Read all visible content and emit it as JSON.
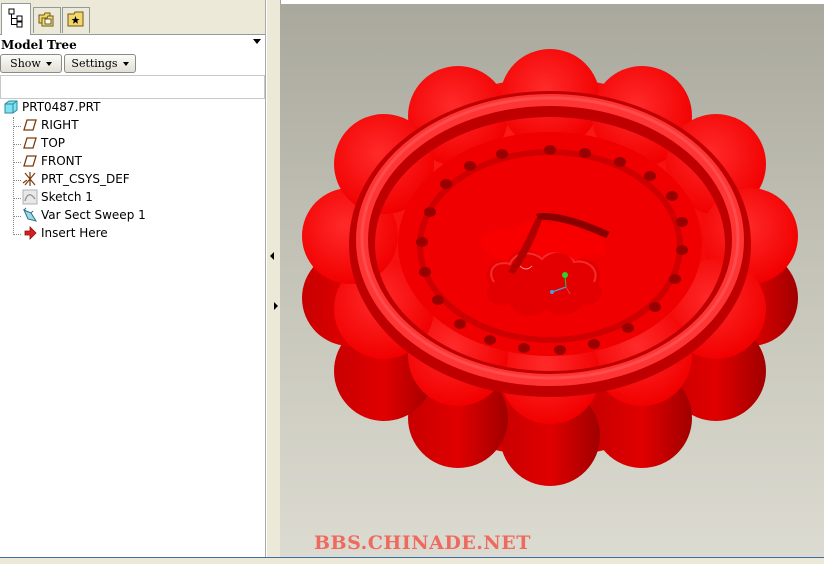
{
  "panel": {
    "title": "Model Tree",
    "tabs": [
      {
        "icon": "model-tree-icon",
        "active": true
      },
      {
        "icon": "folder-browser-icon",
        "active": false
      },
      {
        "icon": "favorites-icon",
        "active": false
      }
    ],
    "toolbar": {
      "show_label": "Show",
      "settings_label": "Settings"
    }
  },
  "tree": {
    "items": [
      {
        "label": "PRT0487.PRT",
        "icon": "part-icon"
      },
      {
        "label": "RIGHT",
        "icon": "datum-plane-icon"
      },
      {
        "label": "TOP",
        "icon": "datum-plane-icon"
      },
      {
        "label": "FRONT",
        "icon": "datum-plane-icon"
      },
      {
        "label": "PRT_CSYS_DEF",
        "icon": "coordinate-system-icon"
      },
      {
        "label": "Sketch 1",
        "icon": "sketch-icon"
      },
      {
        "label": "Var Sect Sweep 1",
        "icon": "sweep-icon"
      },
      {
        "label": "Insert Here",
        "icon": "insert-arrow-icon"
      }
    ]
  },
  "viewport": {
    "watermark": "BBS.CHINADE.NET",
    "model_color": "#ff1a1a",
    "background_top": "#a9a89d",
    "background_bottom": "#dcdbd1"
  }
}
